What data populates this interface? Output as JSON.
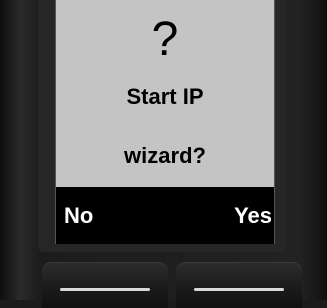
{
  "dialog": {
    "icon": "?",
    "line1": "Start IP",
    "line2": "wizard?"
  },
  "softkeys": {
    "left_label": "No",
    "right_label": "Yes"
  },
  "hardware": {
    "left_key_icon": "minus-line-icon",
    "right_key_icon": "minus-line-icon"
  }
}
